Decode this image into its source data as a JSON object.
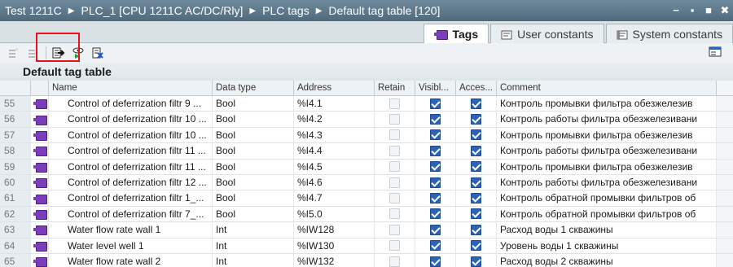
{
  "titlebar": {
    "crumbs": [
      "Test 1211C",
      "PLC_1 [CPU 1211C AC/DC/Rly]",
      "PLC tags",
      "Default tag table [120]"
    ],
    "win_buttons": [
      "−",
      "▪",
      "■",
      "✖"
    ]
  },
  "tabs": [
    {
      "label": "Tags",
      "icon": "tag-icon",
      "active": true
    },
    {
      "label": "User constants",
      "icon": "user-constants-icon",
      "active": false
    },
    {
      "label": "System constants",
      "icon": "system-constants-icon",
      "active": false
    }
  ],
  "toolbar": {
    "icons": [
      "add-row-icon",
      "insert-row-icon",
      "export-icon",
      "monitor-icon",
      "delete-icon"
    ],
    "right_icon": "view-options-icon"
  },
  "table": {
    "title": "Default tag table",
    "columns": [
      "Name",
      "Data type",
      "Address",
      "Retain",
      "Visibl...",
      "Acces...",
      "Comment"
    ],
    "rows": [
      {
        "num": "55",
        "name": "Control of deferrization filtr 9 ...",
        "type": "Bool",
        "addr": "%I4.1",
        "comment": "Контроль промывки фильтра обезжелезив"
      },
      {
        "num": "56",
        "name": "Control of deferrization filtr 10 ...",
        "type": "Bool",
        "addr": "%I4.2",
        "comment": "Контроль работы фильтра обезжелезивани"
      },
      {
        "num": "57",
        "name": "Control of deferrization filtr 10 ...",
        "type": "Bool",
        "addr": "%I4.3",
        "comment": "Контроль промывки фильтра обезжелезив"
      },
      {
        "num": "58",
        "name": "Control of deferrization filtr 11 ...",
        "type": "Bool",
        "addr": "%I4.4",
        "comment": "Контроль работы фильтра обезжелезивани"
      },
      {
        "num": "59",
        "name": "Control of deferrization filtr 11 ...",
        "type": "Bool",
        "addr": "%I4.5",
        "comment": "Контроль промывки фильтра обезжелезив"
      },
      {
        "num": "60",
        "name": "Control of deferrization filtr 12 ...",
        "type": "Bool",
        "addr": "%I4.6",
        "comment": "Контроль работы фильтра обезжелезивани"
      },
      {
        "num": "61",
        "name": "Control of deferrization filtr 1_...",
        "type": "Bool",
        "addr": "%I4.7",
        "comment": "Контроль обратной промывки фильтров об"
      },
      {
        "num": "62",
        "name": "Control of deferrization filtr 7_...",
        "type": "Bool",
        "addr": "%I5.0",
        "comment": "Контроль обратной промывки фильтров об"
      },
      {
        "num": "63",
        "name": "Water flow rate wall 1",
        "type": "Int",
        "addr": "%IW128",
        "comment": "Расход воды 1 скважины"
      },
      {
        "num": "64",
        "name": "Water level well 1",
        "type": "Int",
        "addr": "%IW130",
        "comment": "Уровень воды 1 скважины"
      },
      {
        "num": "65",
        "name": "Water flow rate wall 2",
        "type": "Int",
        "addr": "%IW132",
        "comment": "Расход воды 2 скважины"
      }
    ]
  }
}
